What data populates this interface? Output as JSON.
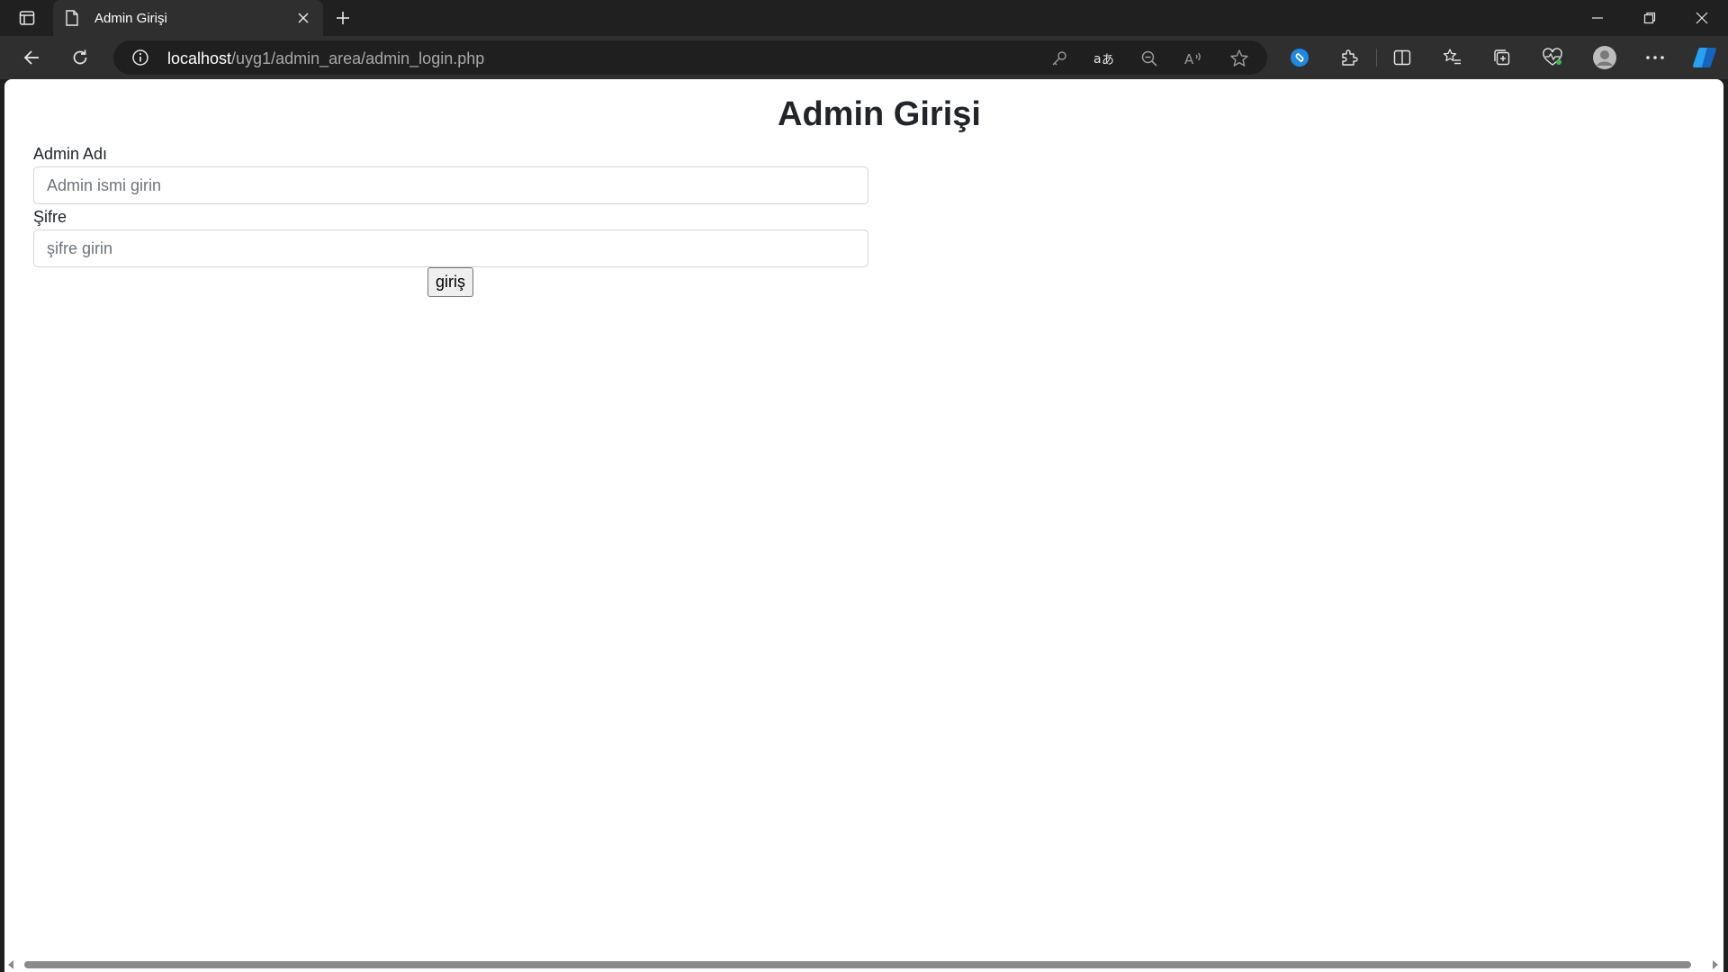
{
  "browser": {
    "tab": {
      "title": "Admin Girişi"
    },
    "address": {
      "host": "localhost",
      "path": "/uyg1/admin_area/admin_login.php"
    }
  },
  "page": {
    "title": "Admin Girişi",
    "username": {
      "label": "Admin Adı",
      "placeholder": "Admin ismi girin",
      "value": ""
    },
    "password": {
      "label": "Şifre",
      "placeholder": "şifre girin",
      "value": ""
    },
    "submit_label": "giriş"
  },
  "colors": {
    "browser_dark": "#202020",
    "toolbar": "#2f2f2f",
    "heading": "#212529",
    "input_border": "#ced4da",
    "accent_blue": "#1e88e5"
  }
}
